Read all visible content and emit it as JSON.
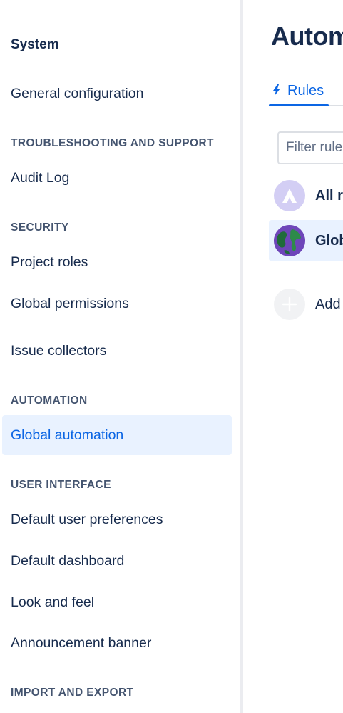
{
  "sidebar": {
    "title": "System",
    "items": [
      {
        "type": "link",
        "label": "General configuration"
      },
      {
        "type": "heading",
        "label": "TROUBLESHOOTING AND SUPPORT"
      },
      {
        "type": "link",
        "label": "Audit Log"
      },
      {
        "type": "heading",
        "label": "SECURITY"
      },
      {
        "type": "link",
        "label": "Project roles"
      },
      {
        "type": "link",
        "label": "Global permissions"
      },
      {
        "type": "link",
        "label": "Issue collectors"
      },
      {
        "type": "heading",
        "label": "AUTOMATION"
      },
      {
        "type": "link",
        "label": "Global automation",
        "active": true
      },
      {
        "type": "heading",
        "label": "USER INTERFACE"
      },
      {
        "type": "link",
        "label": "Default user preferences"
      },
      {
        "type": "link",
        "label": "Default dashboard"
      },
      {
        "type": "link",
        "label": "Look and feel"
      },
      {
        "type": "link",
        "label": "Announcement banner"
      },
      {
        "type": "heading",
        "label": "IMPORT AND EXPORT"
      }
    ]
  },
  "main": {
    "title": "Autom",
    "tabs": [
      {
        "label": "Rules",
        "icon": "bolt-icon",
        "active": true
      }
    ],
    "filter": {
      "placeholder": "Filter rule"
    },
    "list": [
      {
        "label": "All r",
        "icon": "atlassian-logo-icon",
        "bold": true
      },
      {
        "label": "Glob",
        "icon": "globe-icon",
        "bold": true,
        "selected": true
      },
      {
        "label": "Add",
        "icon": "plus-icon",
        "bold": false
      }
    ]
  },
  "colors": {
    "accent": "#0c66e4",
    "active_bg": "#e9f2ff",
    "text": "#172b4d",
    "heading": "#44546f"
  }
}
